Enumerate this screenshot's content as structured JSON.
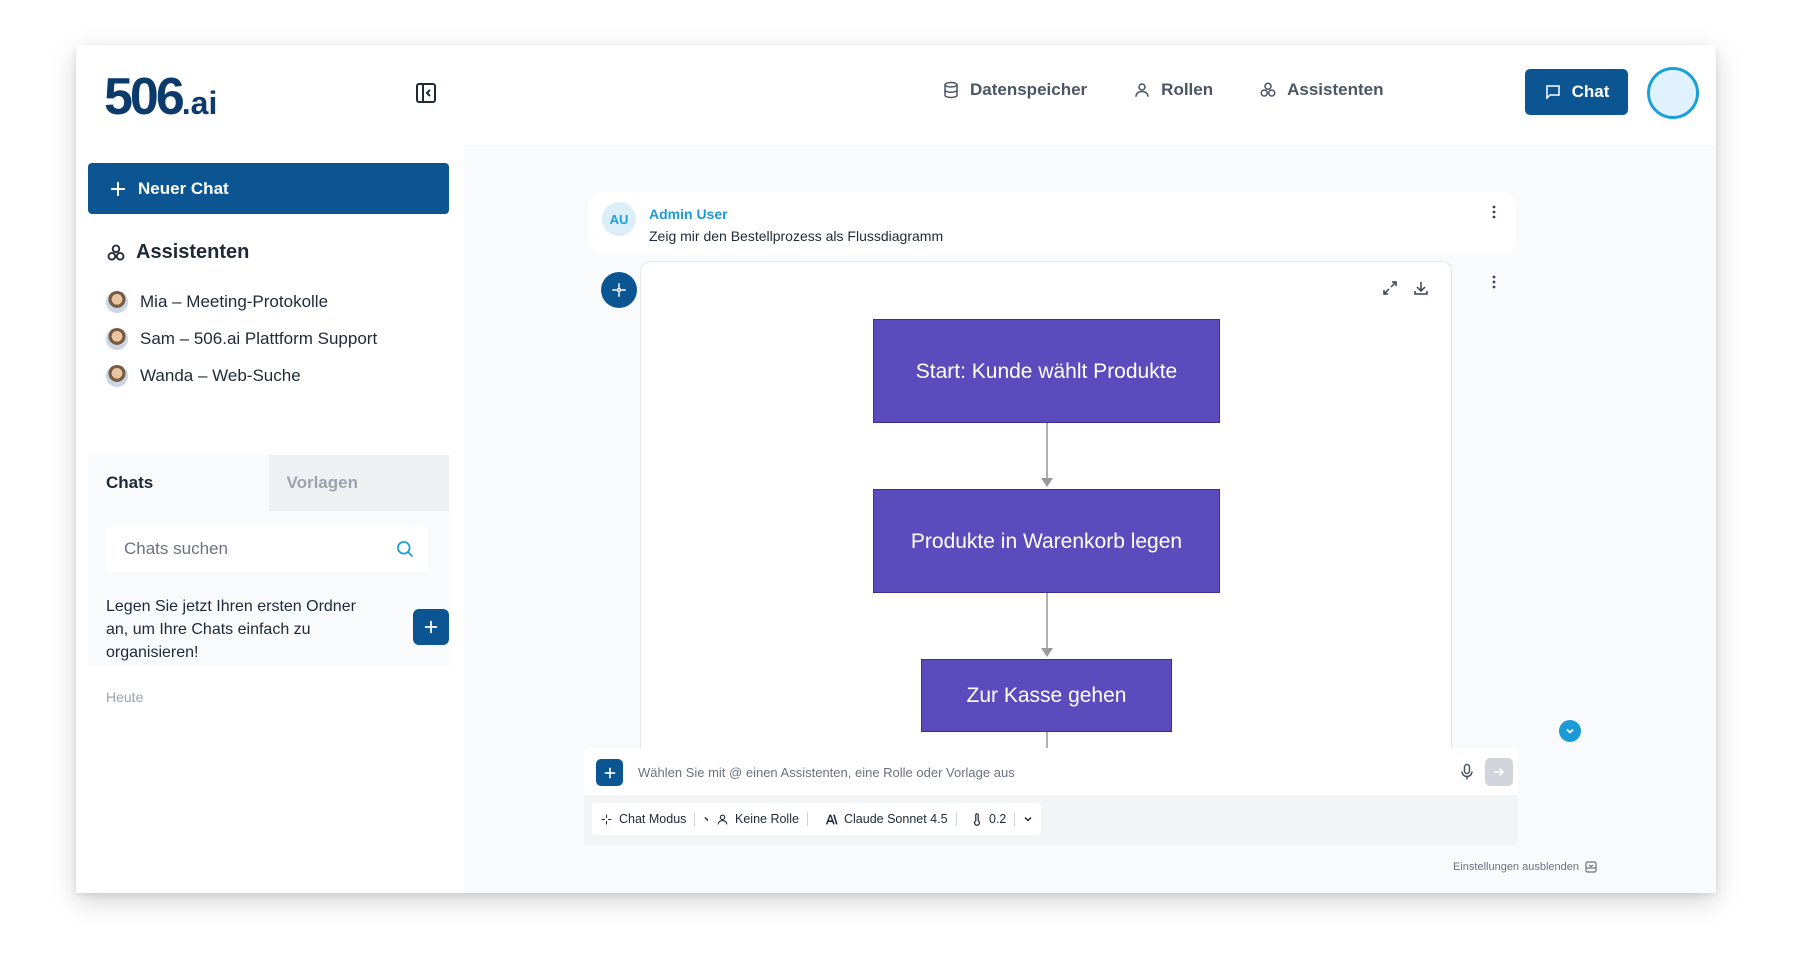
{
  "header": {
    "logo_main": "506",
    "logo_suffix": ".ai",
    "nav": [
      {
        "label": "Datenspeicher",
        "icon": "database-icon"
      },
      {
        "label": "Rollen",
        "icon": "user-icon"
      },
      {
        "label": "Assistenten",
        "icon": "assistants-icon"
      }
    ],
    "chat_button_label": "Chat"
  },
  "sidebar": {
    "new_chat_label": "Neuer Chat",
    "assistants_heading": "Assistenten",
    "assistants": [
      {
        "label": "Mia – Meeting-Protokolle"
      },
      {
        "label": "Sam – 506.ai Plattform Support"
      },
      {
        "label": "Wanda – Web-Suche"
      }
    ],
    "tabs": [
      {
        "label": "Chats",
        "active": true
      },
      {
        "label": "Vorlagen",
        "active": false
      }
    ],
    "search_placeholder": "Chats suchen",
    "folder_hint": "Legen Sie jetzt Ihren ersten Ordner an, um Ihre Chats einfach zu organisieren!",
    "section_today": "Heute"
  },
  "conversation": {
    "user_initials": "AU",
    "user_name": "Admin User",
    "user_message": "Zeig mir den Bestellprozess als Flussdiagramm",
    "flowchart_nodes": [
      {
        "label": "Start: Kunde wählt Produkte"
      },
      {
        "label": "Produkte in Warenkorb legen"
      },
      {
        "label": "Zur Kasse gehen"
      }
    ]
  },
  "composer": {
    "placeholder": "Wählen Sie mit @ einen Assistenten, eine Rolle oder Vorlage aus",
    "settings": [
      {
        "label": "Chat Modus",
        "icon": "sparkle-icon"
      },
      {
        "label": "Keine Rolle",
        "icon": "user-icon"
      },
      {
        "label": "Claude Sonnet 4.5",
        "icon": "anthropic-icon"
      },
      {
        "label": "0.2",
        "icon": "thermometer-icon"
      }
    ],
    "hide_settings_label": "Einstellungen ausblenden"
  },
  "colors": {
    "primary": "#0b5592",
    "accent": "#1a9ad6",
    "node_fill": "#5b4bbd"
  }
}
